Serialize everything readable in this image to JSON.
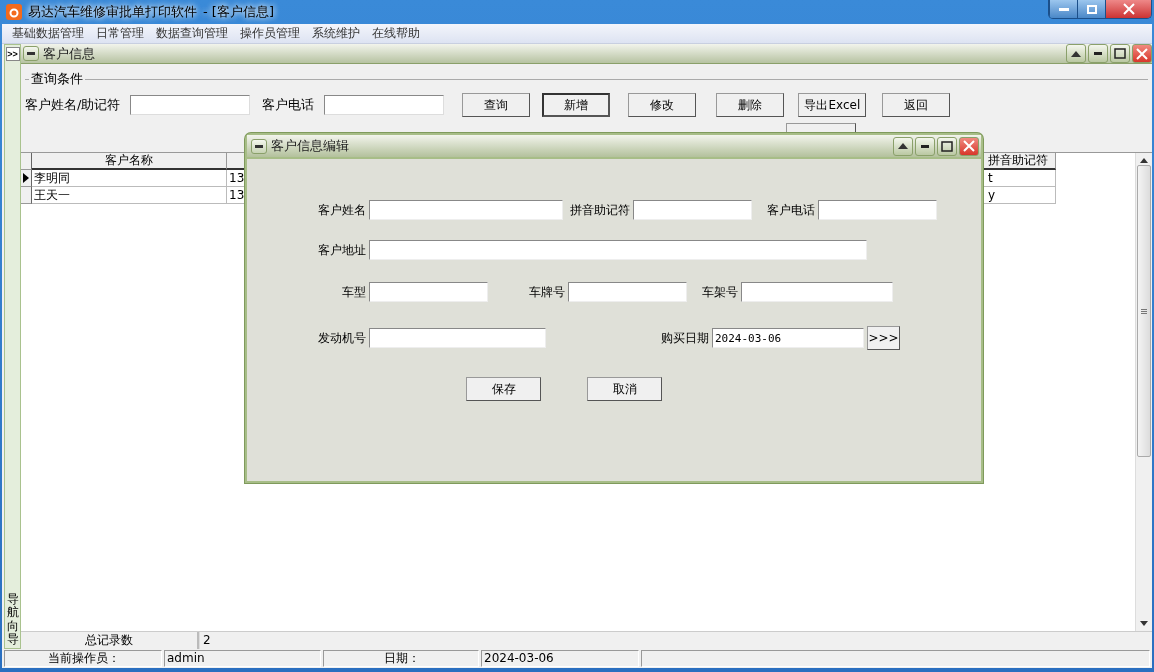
{
  "window": {
    "app_name": "易达汽车维修审批单打印软件",
    "document": "- [客户信息]"
  },
  "menu": [
    "基础数据管理",
    "日常管理",
    "数据查询管理",
    "操作员管理",
    "系统维护",
    "在线帮助"
  ],
  "nav_panel": {
    "toggle": ">>",
    "label": "导航向导"
  },
  "child_window": {
    "title": "客户信息"
  },
  "query": {
    "legend": "查询条件",
    "fields": [
      {
        "label": "客户姓名/助记符"
      },
      {
        "label": "客户电话"
      }
    ],
    "buttons": [
      {
        "label": "查询",
        "focused": false
      },
      {
        "label": "新增",
        "focused": true
      },
      {
        "label": "修改",
        "focused": false
      },
      {
        "label": "删除",
        "focused": false
      },
      {
        "label": "导出Excel",
        "focused": false
      },
      {
        "label": "返回",
        "focused": false
      }
    ]
  },
  "table": {
    "columns": [
      "客户名称",
      "",
      "拼音助记符"
    ],
    "rows": [
      {
        "selected": true,
        "cells": [
          "李明同",
          "13",
          "t"
        ]
      },
      {
        "selected": false,
        "cells": [
          "王天一",
          "13",
          "y"
        ]
      }
    ]
  },
  "summary": {
    "label": "总记录数",
    "value": "2"
  },
  "status_bar": [
    "当前操作员：",
    "admin",
    "日期：",
    "2024-03-06"
  ],
  "dialog": {
    "title": "客户信息编辑",
    "rows": [
      [
        {
          "label": "客户姓名"
        },
        {
          "label": "拼音助记符"
        },
        {
          "label": "客户电话"
        }
      ],
      [
        {
          "label": "客户地址"
        }
      ],
      [
        {
          "label": "车型"
        },
        {
          "label": "车牌号"
        },
        {
          "label": "车架号"
        }
      ],
      [
        {
          "label": "发动机号"
        },
        {
          "kind": "spacer"
        },
        {
          "label": "购买日期",
          "value": "2024-03-06",
          "button": ">>>"
        }
      ]
    ],
    "buttons": [
      "保存",
      "取消"
    ]
  }
}
